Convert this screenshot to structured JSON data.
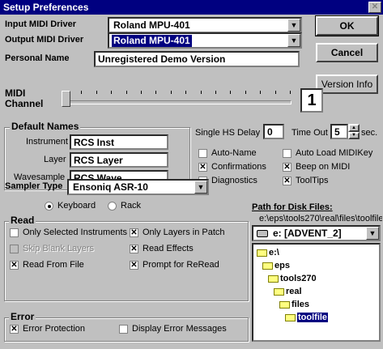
{
  "window": {
    "title": "Setup Preferences",
    "close_glyph": "✕"
  },
  "drivers": {
    "input_label": "Input MIDI Driver",
    "input_value": "Roland MPU-401",
    "output_label": "Output MIDI Driver",
    "output_value": "Roland MPU-401",
    "personal_label": "Personal Name",
    "personal_value": "Unregistered Demo Version"
  },
  "buttons": {
    "ok": "OK",
    "cancel": "Cancel",
    "version": "Version Info"
  },
  "midi_channel": {
    "label_line1": "MIDI",
    "label_line2": "Channel",
    "value": "1",
    "slider_fraction": 0.0
  },
  "default_names": {
    "title": "Default Names",
    "instrument_label": "Instrument",
    "instrument_value": "RCS Inst",
    "layer_label": "Layer",
    "layer_value": "RCS Layer",
    "wavesample_label": "Wavesample",
    "wavesample_value": "RCS Wave"
  },
  "timing": {
    "hs_delay_label": "Single HS Delay",
    "hs_delay_value": "0",
    "timeout_label": "Time Out",
    "timeout_value": "5",
    "timeout_unit": "sec."
  },
  "options": [
    {
      "label": "Auto-Name",
      "checked": false
    },
    {
      "label": "Auto Load MIDIKey",
      "checked": false
    },
    {
      "label": "Confirmations",
      "checked": true
    },
    {
      "label": "Beep on MIDI",
      "checked": true
    },
    {
      "label": "Diagnostics",
      "checked": false
    },
    {
      "label": "ToolTips",
      "checked": true
    }
  ],
  "sampler": {
    "label": "Sampler Type",
    "value": "Ensoniq ASR-10",
    "radio_keyboard": "Keyboard",
    "radio_rack": "Rack",
    "selected": "Keyboard"
  },
  "read": {
    "title": "Read",
    "items": [
      {
        "label": "Only Selected Instruments",
        "checked": false,
        "disabled": false
      },
      {
        "label": "Only Layers in Patch",
        "checked": true,
        "disabled": false
      },
      {
        "label": "Skip Blank Layers",
        "checked": false,
        "disabled": true
      },
      {
        "label": "Read Effects",
        "checked": true,
        "disabled": false
      },
      {
        "label": "Read From File",
        "checked": true,
        "disabled": false
      },
      {
        "label": "Prompt for ReRead",
        "checked": true,
        "disabled": false
      }
    ]
  },
  "error": {
    "title": "Error",
    "items": [
      {
        "label": "Error Protection",
        "checked": true
      },
      {
        "label": "Display Error Messages",
        "checked": false
      }
    ]
  },
  "disk": {
    "path_label": "Path for Disk Files:",
    "path_value": "e:\\eps\\tools270\\real\\files\\toolfile",
    "drive_value": "e: [ADVENT_2]",
    "tree": [
      "e:\\",
      "eps",
      "tools270",
      "real",
      "files",
      "toolfile"
    ],
    "selected": "toolfile"
  },
  "glyphs": {
    "check": "✕",
    "down_arrow": "▼",
    "up_arrow": "▲"
  }
}
